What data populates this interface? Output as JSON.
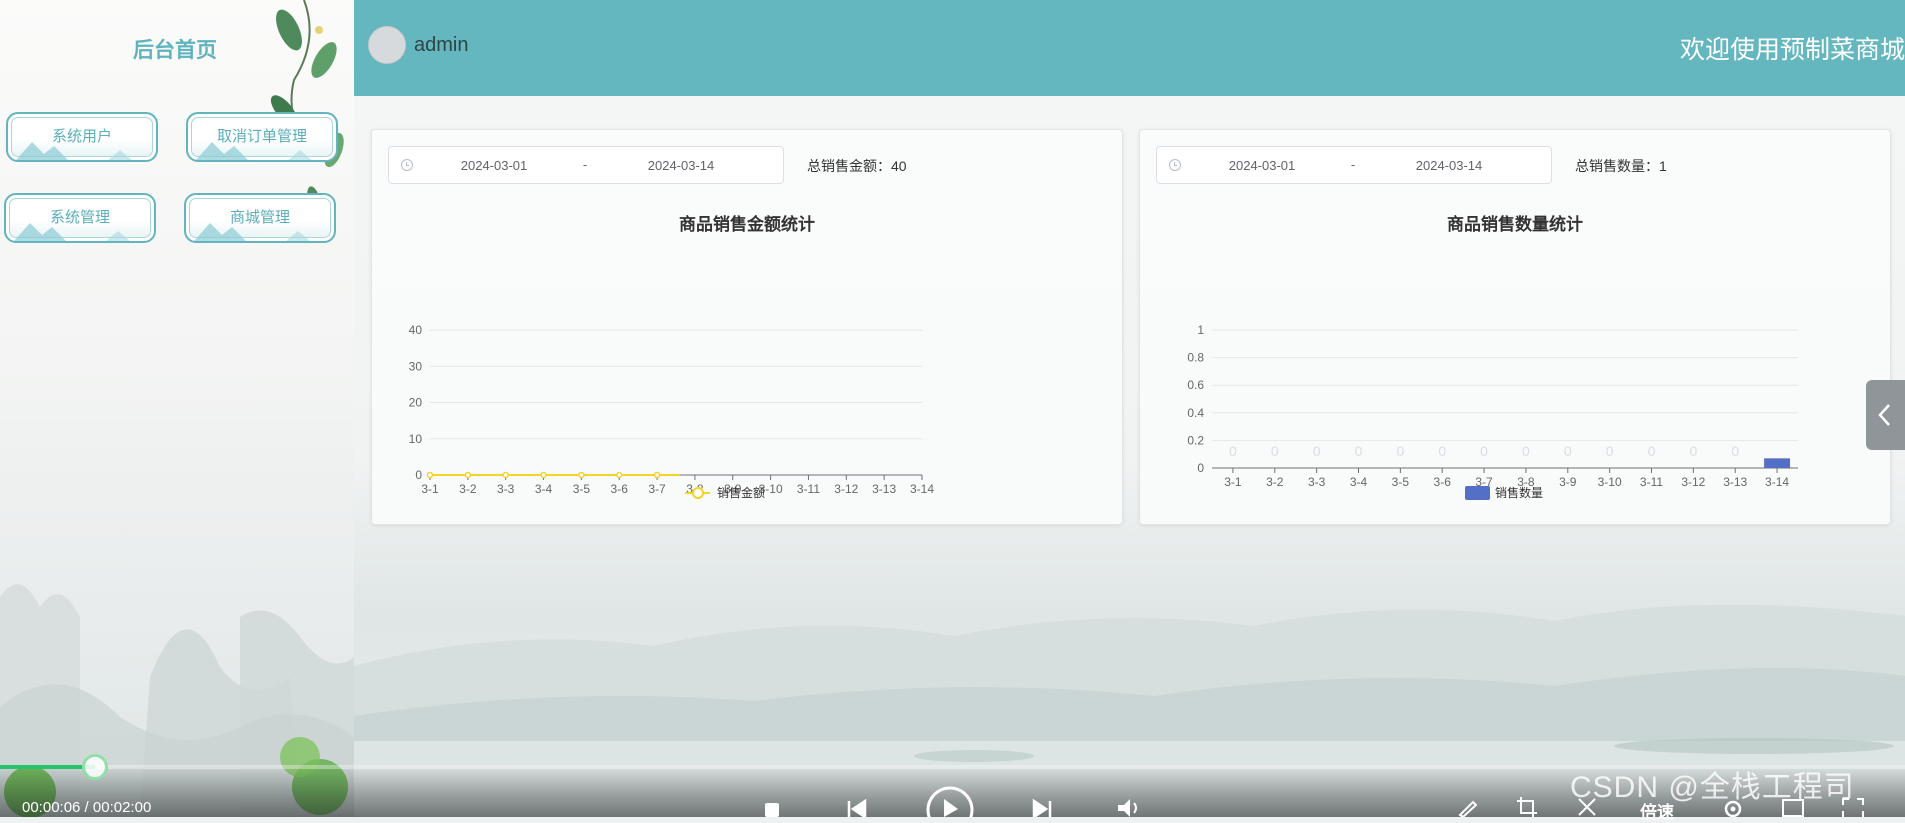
{
  "sidebar": {
    "title": "后台首页",
    "items": [
      {
        "label": "系统用户"
      },
      {
        "label": "取消订单管理"
      },
      {
        "label": "系统管理"
      },
      {
        "label": "商城管理"
      }
    ]
  },
  "header": {
    "username": "admin",
    "welcome": "欢迎使用预制菜商城"
  },
  "cards": [
    {
      "date_start": "2024-03-01",
      "date_sep": "-",
      "date_end": "2024-03-14",
      "total_label": "总销售金额：40"
    },
    {
      "date_start": "2024-03-01",
      "date_sep": "-",
      "date_end": "2024-03-14",
      "total_label": "总销售数量：1"
    }
  ],
  "chart_data": [
    {
      "type": "line",
      "title": "商品销售金额统计",
      "categories": [
        "3-1",
        "3-2",
        "3-3",
        "3-4",
        "3-5",
        "3-6",
        "3-7",
        "3-8",
        "3-9",
        "3-10",
        "3-11",
        "3-12",
        "3-13",
        "3-14"
      ],
      "series": [
        {
          "name": "销售金额",
          "values": [
            0,
            0,
            0,
            0,
            0,
            0,
            0,
            null,
            null,
            null,
            null,
            null,
            null,
            null
          ],
          "color": "#f5d327"
        }
      ],
      "y_ticks": [
        0,
        10,
        20,
        30,
        40
      ],
      "ylim": [
        0,
        40
      ],
      "grid": true,
      "legend": "bottom"
    },
    {
      "type": "bar",
      "title": "商品销售数量统计",
      "categories": [
        "3-1",
        "3-2",
        "3-3",
        "3-4",
        "3-5",
        "3-6",
        "3-7",
        "3-8",
        "3-9",
        "3-10",
        "3-11",
        "3-12",
        "3-13",
        "3-14"
      ],
      "series": [
        {
          "name": "销售数量",
          "values": [
            0,
            0,
            0,
            0,
            0,
            0,
            0,
            0,
            0,
            0,
            0,
            0,
            0,
            0.07
          ],
          "color": "#5470c6"
        }
      ],
      "bar_labels": [
        "0",
        "0",
        "0",
        "0",
        "0",
        "0",
        "0",
        "0",
        "0",
        "0",
        "0",
        "0",
        "0",
        ""
      ],
      "y_ticks": [
        0,
        0.2,
        0.4,
        0.6,
        0.8,
        1
      ],
      "ylim": [
        0,
        1
      ],
      "grid": true,
      "legend": "bottom"
    }
  ],
  "player": {
    "time": "00:00:06 / 00:02:00",
    "progress": 0.05,
    "speed_label": "倍速"
  },
  "watermark": "CSDN @全栈工程司",
  "colors": {
    "header": "#65b7bf",
    "accent": "#5fb3bf",
    "line_series": "#f5d327",
    "bar_series": "#5470c6"
  }
}
